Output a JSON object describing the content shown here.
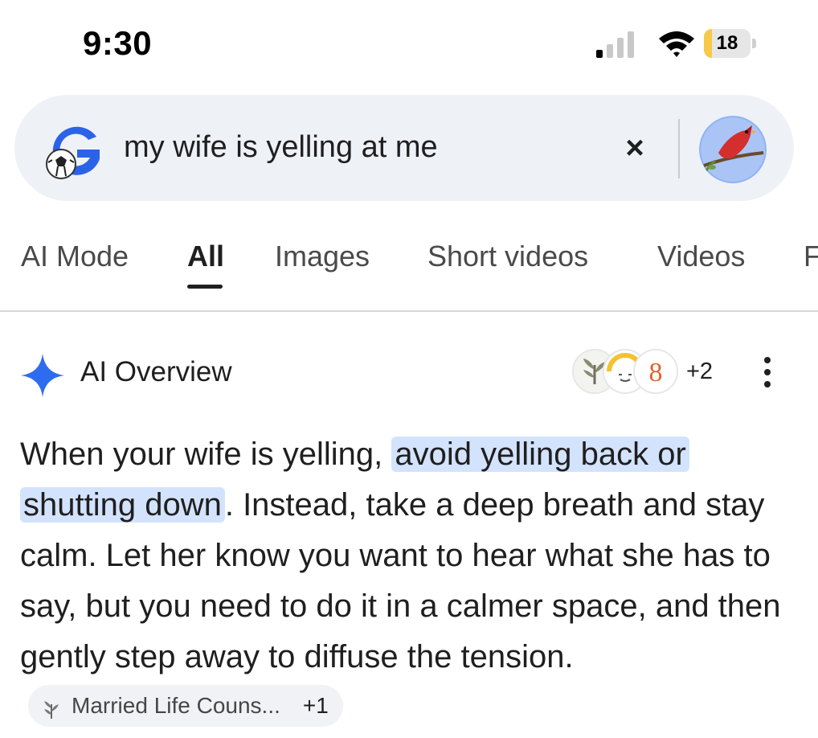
{
  "status_bar": {
    "time": "9:30",
    "battery_level": "18",
    "battery_fraction": 0.18,
    "signal_icon": "cellular-signal-icon",
    "wifi_icon": "wifi-icon"
  },
  "search": {
    "query": "my wife is yelling at me",
    "clear_label": "×",
    "logo_icon": "google-g-soccer-doodle-icon",
    "avatar_icon": "cardinal-bird-avatar-icon"
  },
  "tabs": [
    {
      "label": "AI Mode"
    },
    {
      "label": "All"
    },
    {
      "label": "Images"
    },
    {
      "label": "Short videos"
    },
    {
      "label": "Videos"
    },
    {
      "label": "F"
    }
  ],
  "active_tab": "All",
  "ai_overview": {
    "title": "AI Overview",
    "sources_extra": "+2",
    "text_before": "When your wife is yelling, ",
    "highlight_1": "avoid yelling back or",
    "highlight_2": "shutting down",
    "text_after": ". Instead, take a deep breath and stay calm. Let her know you want to hear what she has to say, but you need to do it in a calmer space, and then gently step away to diffuse the tension.",
    "citation": {
      "label": "Married Life Couns...",
      "count": "+1"
    }
  },
  "colors": {
    "highlight": "#d3e3fd",
    "search_bg": "#eef1f6",
    "battery_fill": "#f7c948",
    "sparkle": "#2d6cf0"
  }
}
